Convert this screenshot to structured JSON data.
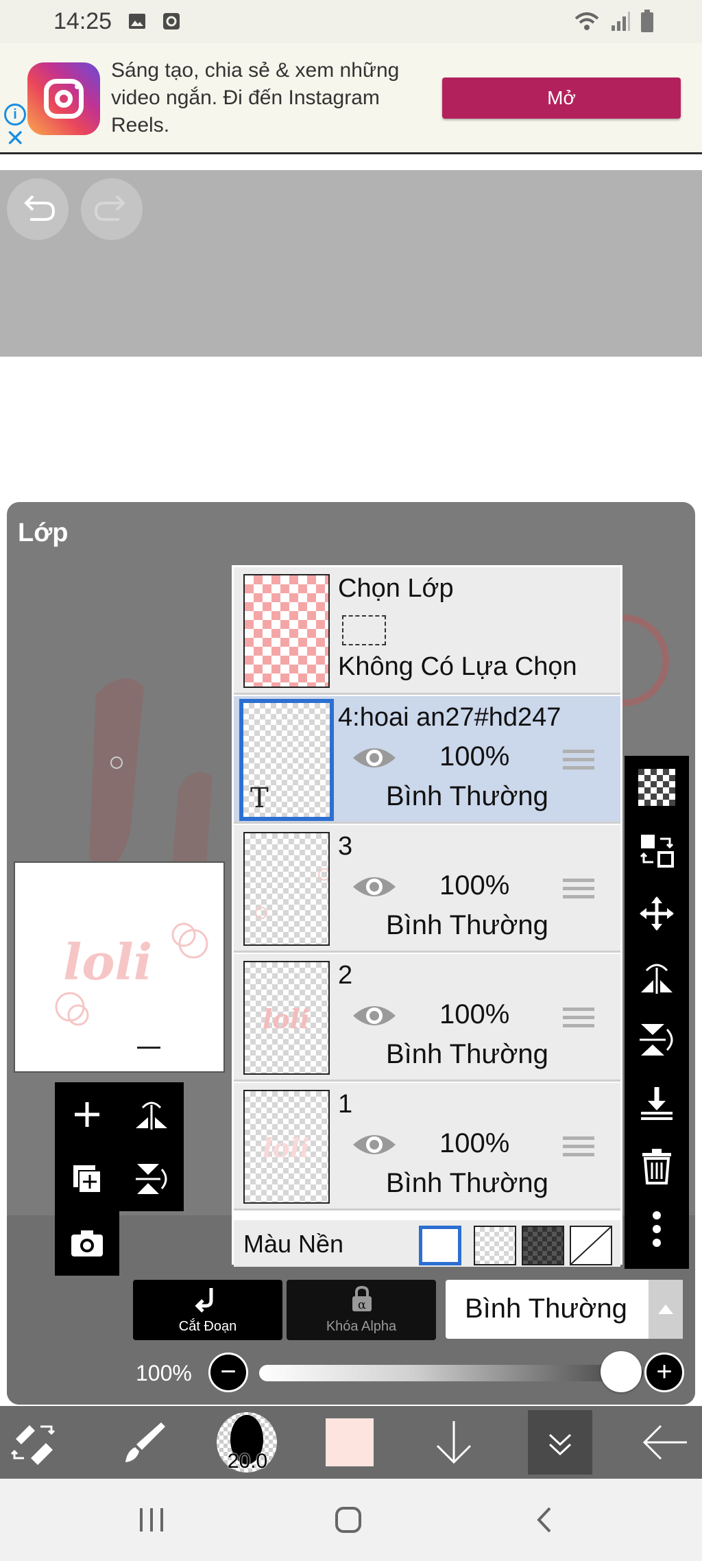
{
  "status_bar": {
    "time": "14:25"
  },
  "ad": {
    "text": "Sáng tạo, chia sẻ & xem những video ngắn. Đi đến Instagram Reels.",
    "button": "Mở",
    "button_color": "#b3215c"
  },
  "panel": {
    "title": "Lớp"
  },
  "selection_row": {
    "title": "Chọn Lớp",
    "status": "Không Có Lựa Chọn"
  },
  "layers": [
    {
      "name": "4:hoai an27#hd247",
      "opacity": "100%",
      "mode": "Bình Thường",
      "selected": true,
      "type_icon": "T"
    },
    {
      "name": "3",
      "opacity": "100%",
      "mode": "Bình Thường",
      "selected": false
    },
    {
      "name": "2",
      "opacity": "100%",
      "mode": "Bình Thường",
      "selected": false
    },
    {
      "name": "1",
      "opacity": "100%",
      "mode": "Bình Thường",
      "selected": false
    }
  ],
  "background": {
    "label": "Màu Nền",
    "options": [
      "white",
      "checker-light",
      "checker-dark",
      "none"
    ],
    "selected": "white"
  },
  "controls": {
    "clip_label": "Cắt Đoạn",
    "alpha_lock_label": "Khóa Alpha",
    "blend_mode": "Bình Thường",
    "opacity": "100%"
  },
  "brush": {
    "size": "20.0"
  },
  "colors": {
    "accent_selected": "#2c6fd1",
    "current_color": "#fde4df"
  }
}
